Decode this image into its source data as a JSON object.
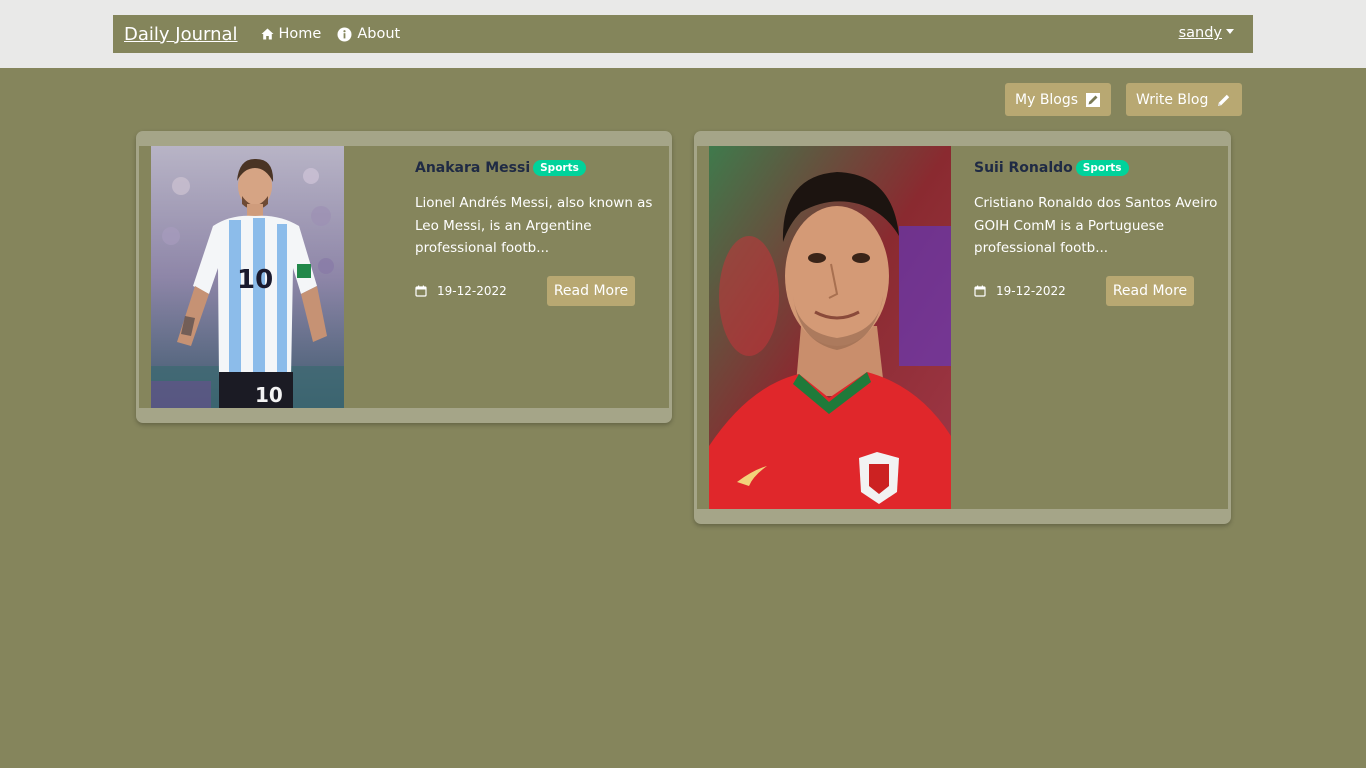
{
  "navbar": {
    "brand": "Daily Journal",
    "links": [
      {
        "label": "Home",
        "icon": "home-icon"
      },
      {
        "label": "About",
        "icon": "info-icon"
      }
    ],
    "user": "sandy"
  },
  "actions": {
    "my_blogs": "My Blogs",
    "write_blog": "Write Blog"
  },
  "posts": [
    {
      "title": "Anakara Messi",
      "category": "Sports",
      "excerpt": "Lionel Andrés Messi, also known as Leo Messi, is an Argentine professional footb...",
      "date": "19-12-2022",
      "read_more": "Read More",
      "image_alt": "Player in Argentina jersey number 10"
    },
    {
      "title": "Suii Ronaldo",
      "category": "Sports",
      "excerpt": "Cristiano Ronaldo dos Santos Aveiro GOIH ComM is a Portuguese professional footb...",
      "date": "19-12-2022",
      "read_more": "Read More",
      "image_alt": "Player in Portugal red jersey"
    }
  ],
  "colors": {
    "page_bg": "#85855c",
    "navbar_bg": "#84855b",
    "button_bg": "#b8a872",
    "badge_bg": "#00d39b",
    "title_color": "#1f2a44"
  }
}
